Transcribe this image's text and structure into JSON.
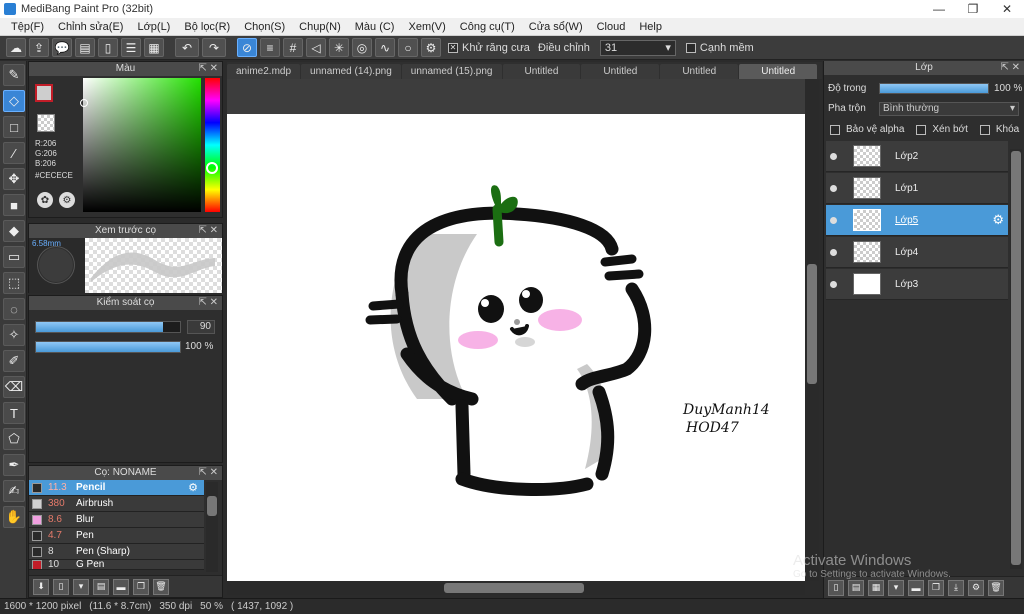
{
  "window": {
    "title": "MediBang Paint Pro (32bit)",
    "controls": [
      "—",
      "❐",
      "✕"
    ]
  },
  "menu": [
    "Tệp(F)",
    "Chỉnh sửa(E)",
    "Lớp(L)",
    "Bộ lọc(R)",
    "Chọn(S)",
    "Chụp(N)",
    "Màu (C)",
    "Xem(V)",
    "Công cụ(T)",
    "Cửa sổ(W)",
    "Cloud",
    "Help"
  ],
  "toolbar": {
    "antialias_label": "Khử răng cưa",
    "adjust_label": "Điều chỉnh",
    "adjust_value": "31",
    "soft_edge_label": "Cạnh mềm"
  },
  "color_panel": {
    "title": "Màu",
    "r": "R:206",
    "g": "G:206",
    "b": "B:206",
    "hex": "#CECECE",
    "fg_color": "#cecece",
    "fg_border": "#c21d28"
  },
  "brush_preview": {
    "title": "Xem trước cọ",
    "size": "6.58mm"
  },
  "brush_control": {
    "title": "Kiểm soát cọ",
    "size_value": "90",
    "opacity_value": "100 %"
  },
  "brush_list": {
    "title": "Cọ: NONAME",
    "items": [
      {
        "size": "11.3",
        "name": "Pencil",
        "color": "#2a2a2a"
      },
      {
        "size": "380",
        "name": "Airbrush",
        "color": "#d0d0d0"
      },
      {
        "size": "8.6",
        "name": "Blur",
        "color": "#f0a0e0"
      },
      {
        "size": "4.7",
        "name": "Pen",
        "color": "#2a2a2a"
      },
      {
        "size": "8",
        "name": "Pen (Sharp)",
        "color": "#2a2a2a"
      },
      {
        "size": "10",
        "name": "G Pen",
        "color": "#c21d28"
      }
    ]
  },
  "tabs": [
    "anime2.mdp",
    "unnamed (14).png",
    "unnamed (15).png",
    "Untitled",
    "Untitled",
    "Untitled",
    "Untitled"
  ],
  "canvas": {
    "signature_line1": "DuyManh14",
    "signature_line2": "HOD47"
  },
  "layer_panel": {
    "title": "Lớp",
    "opacity_label": "Độ trong",
    "opacity_value": "100 %",
    "blend_label": "Pha trộn",
    "blend_value": "Bình thường",
    "protect_alpha": "Bảo vệ alpha",
    "clipping": "Xén bớt",
    "lock": "Khóa",
    "layers": [
      "Lớp2",
      "Lớp1",
      "Lớp5",
      "Lớp4",
      "Lớp3"
    ]
  },
  "status": {
    "size": "1600 * 1200 pixel",
    "dims": "(11.6 * 8.7cm)",
    "dpi": "350 dpi",
    "zoom": "50 %",
    "coords": "( 1437, 1092 )"
  },
  "watermark": {
    "line1": "Activate Windows",
    "line2": "Go to Settings to activate Windows."
  }
}
